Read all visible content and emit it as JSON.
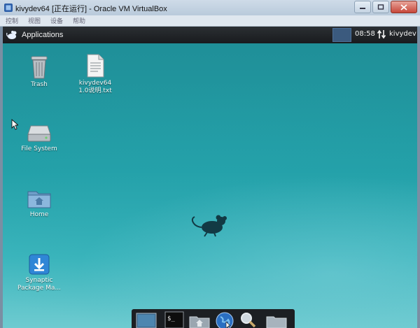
{
  "host_window": {
    "title": "kivydev64 [正在运行] - Oracle VM VirtualBox",
    "menu": [
      "控制",
      "视图",
      "设备",
      "帮助"
    ]
  },
  "panel": {
    "apps_label": "Applications",
    "clock": "08:58",
    "user": "kivydev"
  },
  "desktop": {
    "icons": [
      {
        "label": "Trash",
        "icon": "trash-icon"
      },
      {
        "label": "kivydev64\n1.0说明.txt",
        "icon": "text-file-icon"
      },
      {
        "label": "File System",
        "icon": "drive-icon"
      },
      {
        "label": "Home",
        "icon": "home-folder-icon"
      },
      {
        "label": "Synaptic\nPackage Ma...",
        "icon": "synaptic-icon"
      }
    ]
  },
  "dock": {
    "items": [
      "show-desktop-icon",
      "terminal-icon",
      "file-manager-icon",
      "web-browser-icon",
      "app-finder-icon",
      "folder-icon"
    ],
    "terminal_glyph": "$_"
  },
  "colors": {
    "desktop_top": "#1f8f98",
    "desktop_bottom": "#6ecbd0",
    "panel": "#1d2023",
    "workspace_active": "#3b5a7e"
  }
}
